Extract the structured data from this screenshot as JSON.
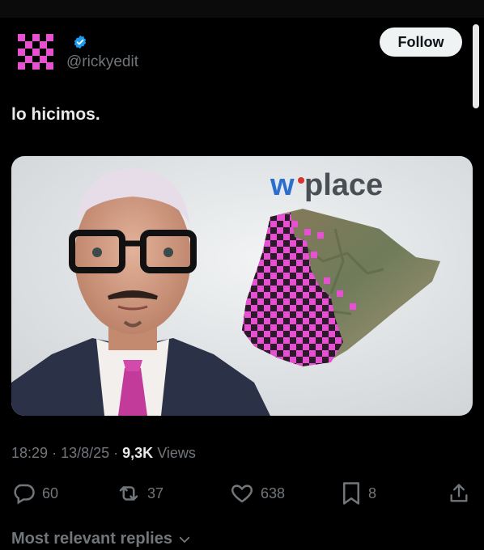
{
  "author": {
    "handle": "@rickyedit",
    "avatar_icon": "pink-checkerboard-icon",
    "verified_icon": "verified-badge-icon"
  },
  "follow_label": "Follow",
  "tweet": {
    "text": "lo hicimos.",
    "media": {
      "logo_text_w": "w",
      "logo_text_rest": "place",
      "description_icon": "thumbnail-man-with-glasses-and-pixelated-map"
    }
  },
  "meta": {
    "time": "18:29",
    "date": "13/8/25",
    "views_count": "9,3K",
    "views_label": "Views"
  },
  "actions": {
    "replies": "60",
    "reposts": "37",
    "likes": "638",
    "bookmarks": "8"
  },
  "replies_heading": "Most relevant replies",
  "colors": {
    "accent_pink": "#e94fd2",
    "verified_blue": "#1d9bf0",
    "muted": "#71767b",
    "text": "#e7e9ea"
  }
}
